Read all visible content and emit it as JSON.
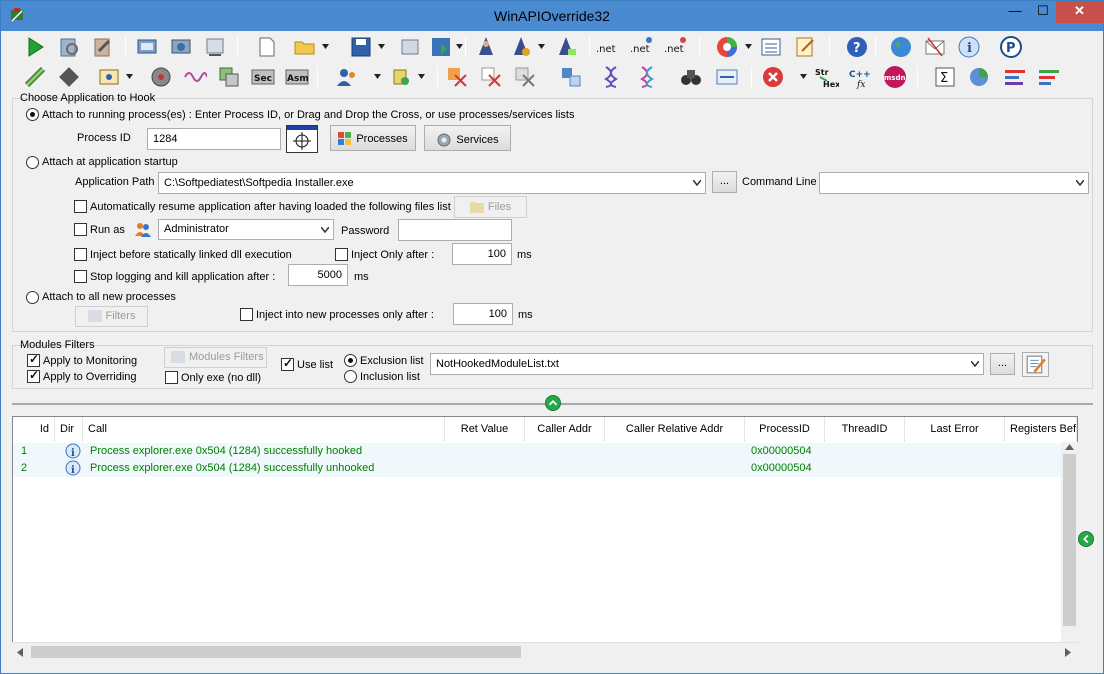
{
  "window": {
    "title": "WinAPIOverride32",
    "min": "—",
    "max": "☐",
    "close": "✕"
  },
  "hook_group": {
    "title": "Choose Application to Hook",
    "attach_running_label": "Attach to running process(es) : Enter Process ID, or Drag and Drop the Cross, or use processes/services lists",
    "process_id_label": "Process ID",
    "process_id_value": "1284",
    "processes_btn": "Processes",
    "services_btn": "Services",
    "attach_startup_label": "Attach at application startup",
    "app_path_label": "Application Path",
    "app_path_value": "C:\\Softpediatest\\Softpedia Installer.exe",
    "browse_btn": "...",
    "cmdline_label": "Command Line",
    "cmdline_value": "",
    "auto_resume_label": "Automatically resume application after having loaded the following files list",
    "files_btn": "Files",
    "run_as_label": "Run as",
    "run_as_value": "Administrator",
    "password_label": "Password",
    "password_value": "",
    "inject_static_label": "Inject before statically linked dll execution",
    "inject_only_after_label": "Inject Only after :",
    "inject_only_after_value": "100",
    "ms1": "ms",
    "stop_logging_label": "Stop logging and kill application after :",
    "stop_logging_value": "5000",
    "ms2": "ms",
    "attach_new_label": "Attach to all new processes",
    "filters_btn": "Filters",
    "inject_new_label": "Inject into new processes only after :",
    "inject_new_value": "100",
    "ms3": "ms"
  },
  "modules_group": {
    "title": "Modules Filters",
    "apply_monitoring": "Apply to Monitoring",
    "apply_overriding": "Apply to Overriding",
    "modules_filters_btn": "Modules Filters",
    "only_exe": "Only exe (no dll)",
    "use_list": "Use list",
    "exclusion_list": "Exclusion list",
    "inclusion_list": "Inclusion list",
    "list_file": "NotHookedModuleList.txt",
    "browse_btn": "..."
  },
  "table": {
    "columns": [
      "Id",
      "Dir",
      "Call",
      "Ret Value",
      "Caller Addr",
      "Caller Relative Addr",
      "ProcessID",
      "ThreadID",
      "Last Error",
      "Registers Befo"
    ],
    "rows": [
      {
        "id": "1",
        "call": "Process explorer.exe 0x504 (1284) successfully hooked",
        "pid": "0x00000504"
      },
      {
        "id": "2",
        "call": "Process explorer.exe 0x504 (1284) successfully unhooked",
        "pid": "0x00000504"
      }
    ]
  },
  "toolbar_icons": {
    "row1": [
      "start-icon",
      "monitoring-files-icon",
      "overriding-files-icon",
      "load-icon",
      "unload-icon",
      "hook-com-icon",
      "new-icon",
      "open-icon",
      "save-icon",
      "export-icon",
      "save-as-icon",
      "dumper-icon",
      "dumper2-icon",
      "dumper3-icon",
      "dotnet-icon",
      "dotnet2-icon",
      "dotnet3-icon",
      "colors-icon",
      "list-icon",
      "notepad-icon",
      "help-icon",
      "globe-icon",
      "mail-icon",
      "info-icon",
      "donate-icon"
    ],
    "row2": [
      "memory-icon",
      "chip-icon",
      "window-icon",
      "cd-icon",
      "wave-icon",
      "copy-icon",
      "sec-icon",
      "asm-icon",
      "users-icon",
      "plugin-icon",
      "filter-add-icon",
      "filter-remove-icon",
      "filter-clear-icon",
      "transform-icon",
      "dna-icon",
      "dna2-icon",
      "binoculars-icon",
      "find-icon",
      "close-red-icon",
      "str-hex-icon",
      "cpp-icon",
      "msdn-icon",
      "sum-icon",
      "pie-icon",
      "bars-icon",
      "bars2-icon"
    ]
  }
}
